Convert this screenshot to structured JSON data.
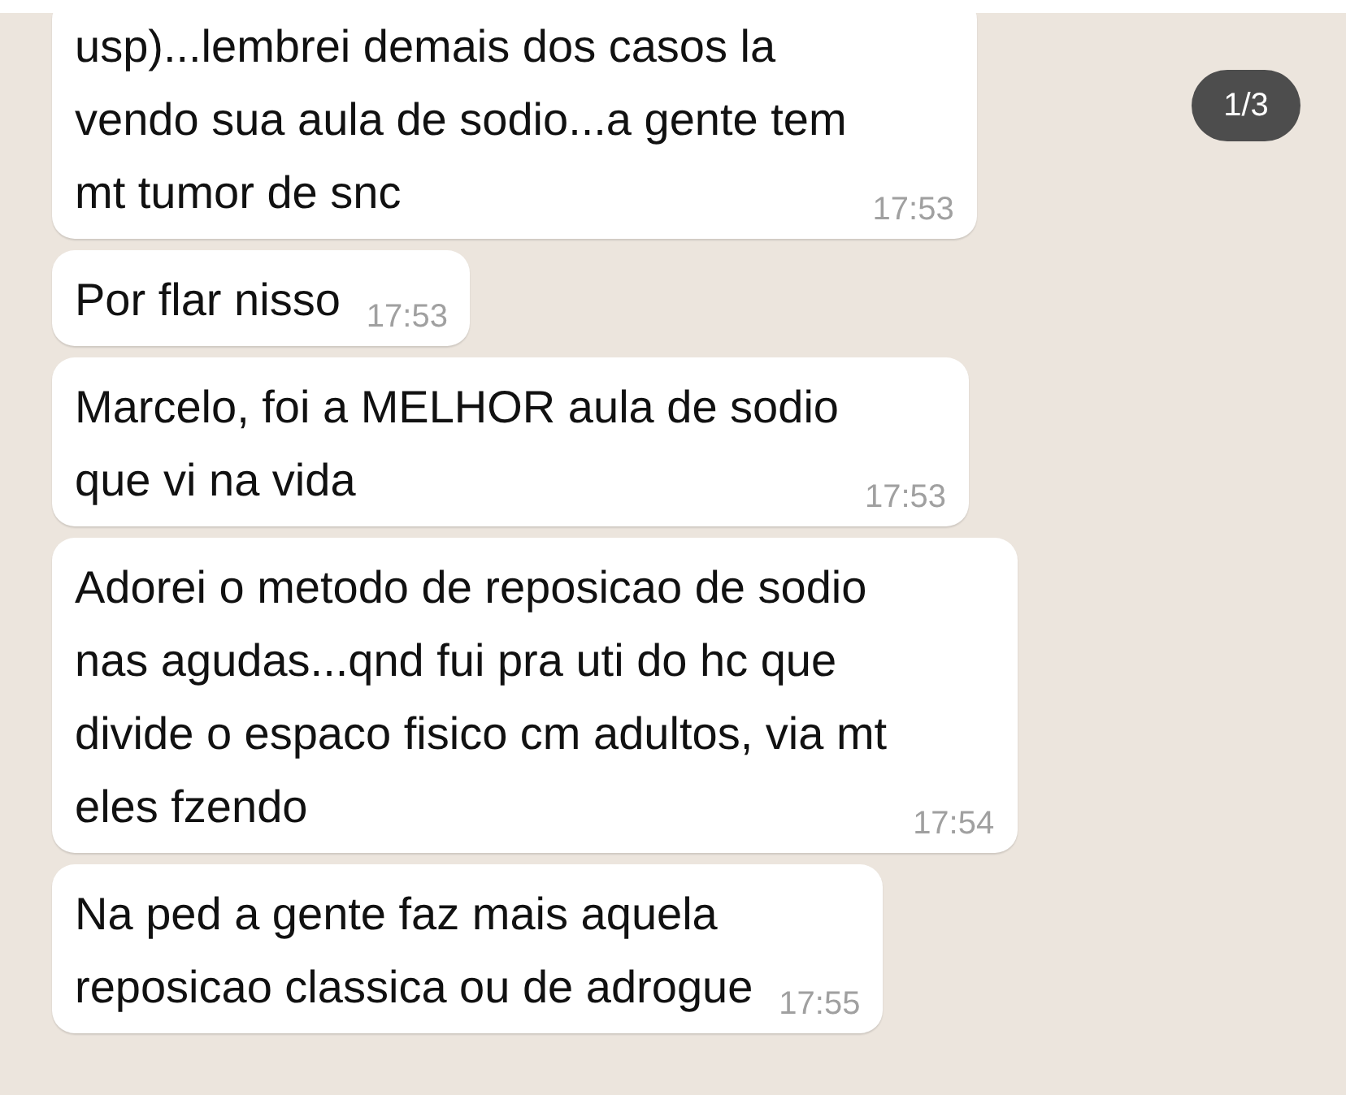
{
  "page_indicator": "1/3",
  "messages": [
    {
      "lines": [
        "usp)...lembrei demais dos casos la",
        "vendo sua aula de sodio...a gente tem",
        "mt tumor de snc"
      ],
      "time": "17:53"
    },
    {
      "lines": [
        "Por flar nisso"
      ],
      "time": "17:53"
    },
    {
      "lines": [
        "Marcelo, foi a MELHOR aula de sodio",
        "que vi na vida"
      ],
      "time": "17:53"
    },
    {
      "lines": [
        "Adorei o metodo de reposicao de sodio",
        "nas agudas...qnd fui pra uti do hc que",
        "divide o espaco fisico cm adultos, via mt",
        "eles fzendo"
      ],
      "time": "17:54"
    },
    {
      "lines": [
        "Na ped a gente faz mais aquela",
        "reposicao classica ou de adrogue"
      ],
      "time": "17:55"
    }
  ]
}
